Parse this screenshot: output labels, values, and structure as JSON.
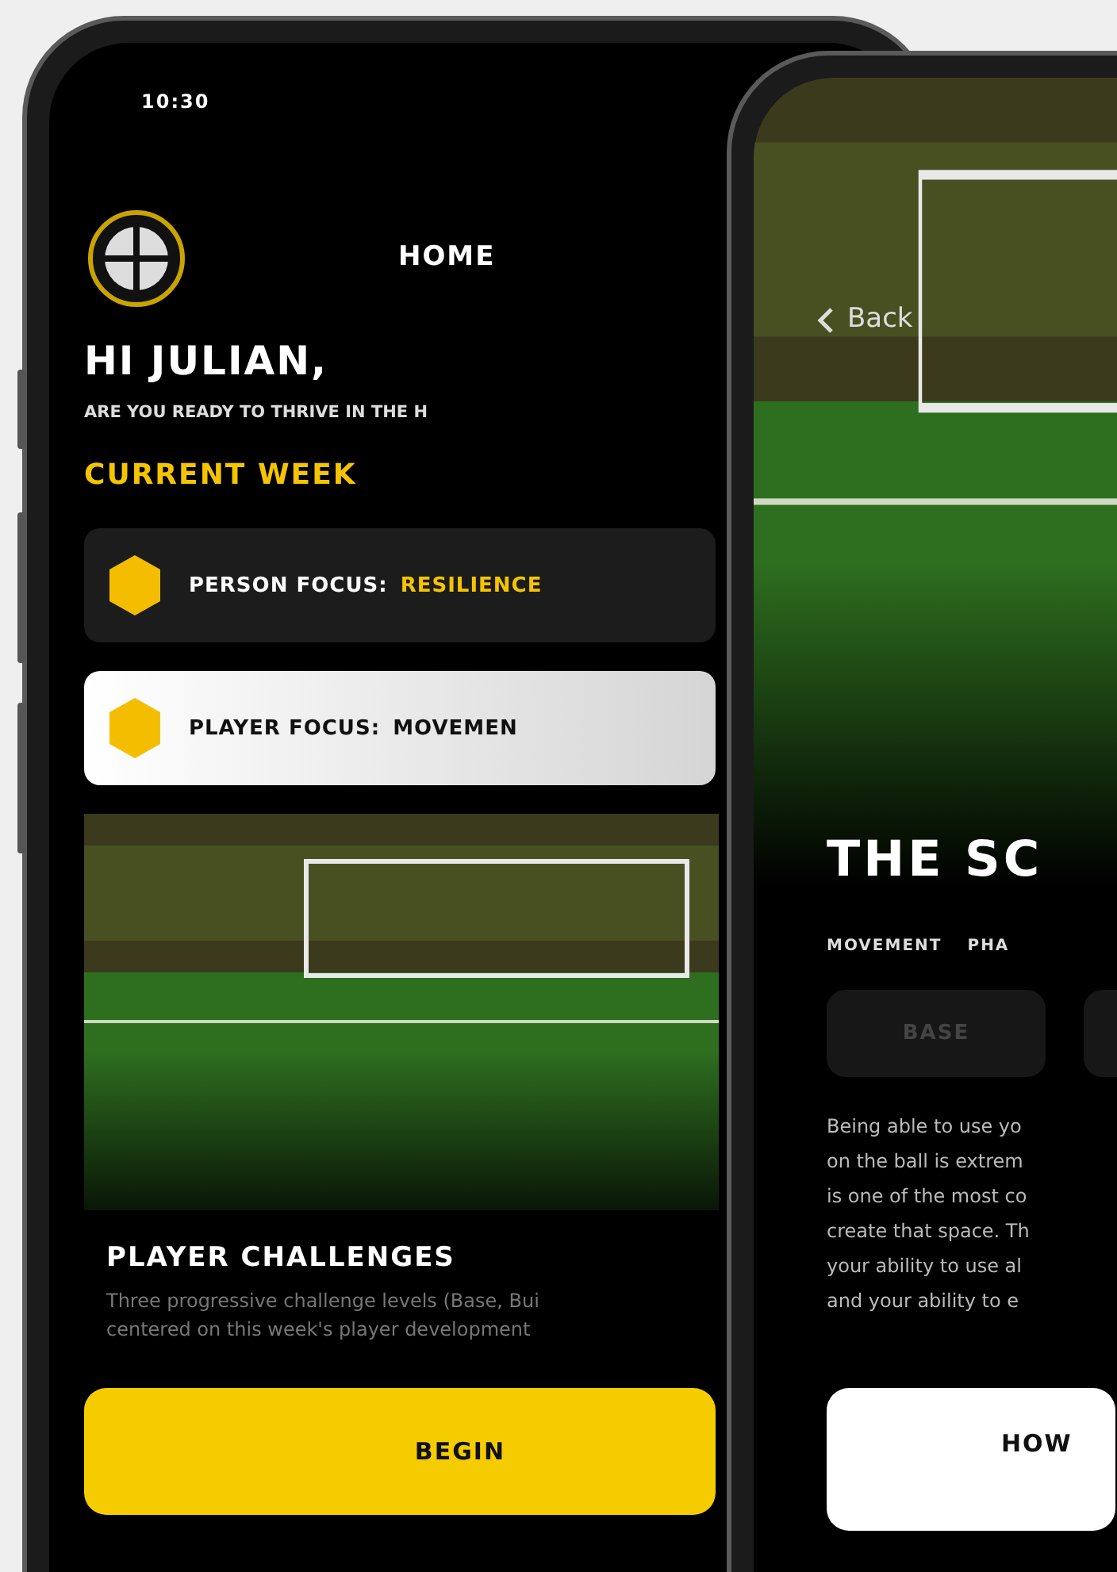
{
  "left_phone": {
    "status_bar": {
      "time": "10:30"
    },
    "header": {
      "title": "HOME"
    },
    "greeting": "HI JULIAN,",
    "subtitle": "ARE YOU READY TO THRIVE IN THE H",
    "section_title": "CURRENT WEEK",
    "focus_cards": [
      {
        "label": "PERSON FOCUS:",
        "value": "RESILIENCE",
        "selected": false
      },
      {
        "label": "PLAYER FOCUS:",
        "value": "MOVEMEN",
        "selected": true
      }
    ],
    "challenge": {
      "title": "PLAYER CHALLENGES",
      "description": [
        "Three progressive challenge levels (Base, Bui",
        "centered on this week's player development"
      ]
    },
    "button": "BEGIN"
  },
  "right_phone": {
    "back": "Back",
    "title": "THE SC",
    "tags": [
      "MOVEMENT",
      "PHA"
    ],
    "level_tabs": [
      {
        "label": "BASE",
        "selected": false
      },
      {
        "selected": false
      }
    ],
    "description": [
      "Being able to use yo",
      "on the ball is extrem",
      "is one of the most co",
      "create that space. Th",
      "your ability to use al",
      "and your ability to e"
    ],
    "button": "HOW"
  }
}
